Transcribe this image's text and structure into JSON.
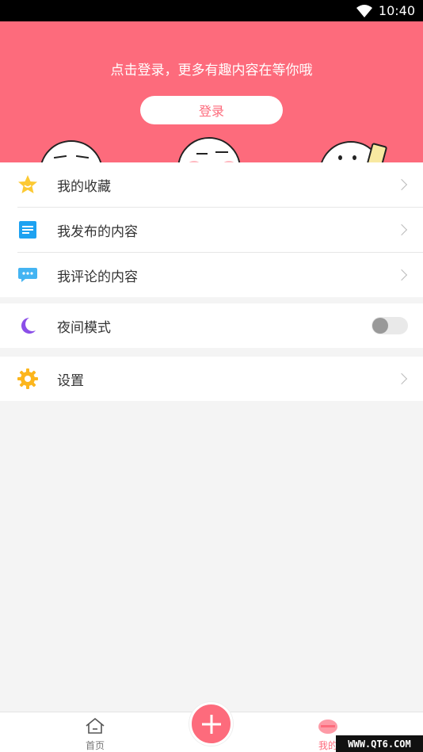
{
  "status_bar": {
    "time": "10:40"
  },
  "header": {
    "prompt": "点击登录，更多有趣内容在等你哦",
    "login_label": "登录"
  },
  "menu": {
    "favorites": "我的收藏",
    "my_posts": "我发布的内容",
    "my_comments": "我评论的内容",
    "night_mode": "夜间模式",
    "settings": "设置"
  },
  "night_mode_on": false,
  "bottom_nav": {
    "home": "首页",
    "mine": "我的"
  },
  "watermark": "WWW.QT6.COM",
  "colors": {
    "accent": "#fd6b7c",
    "favorites_icon": "#fcc933",
    "posts_icon": "#1ea2f1",
    "comments_icon": "#44b4f2",
    "night_icon": "#8b4fe8",
    "settings_icon": "#fcb61d"
  },
  "icons": {
    "favorites": "star-smile-icon",
    "my_posts": "document-icon",
    "my_comments": "chat-bubble-icon",
    "night_mode": "moon-icon",
    "settings": "gear-icon",
    "home": "home-icon",
    "mine": "mine-icon",
    "publish": "plus-icon"
  }
}
